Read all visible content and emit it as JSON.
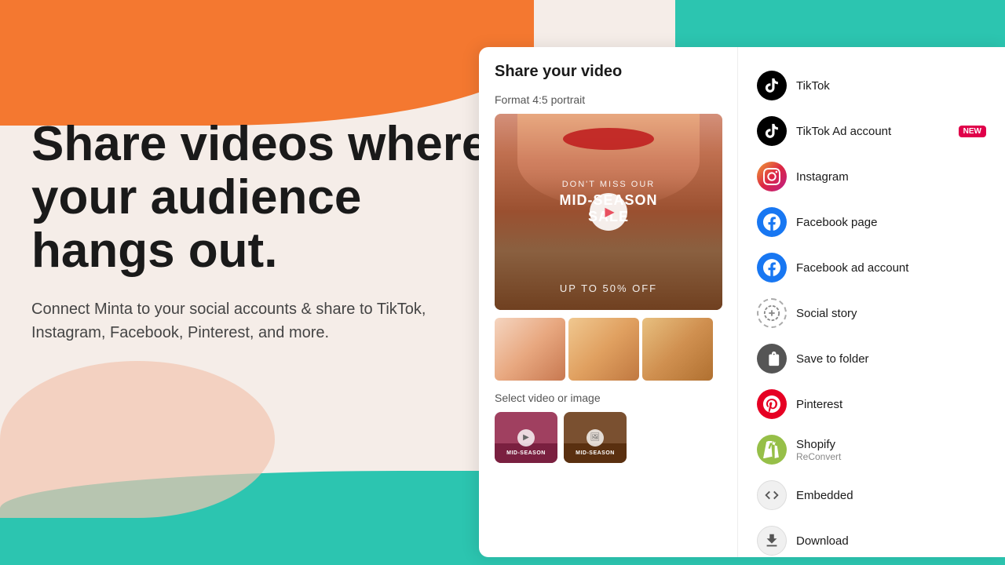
{
  "background": {
    "colors": {
      "orange": "#f47830",
      "teal": "#2cc5b0",
      "pink": "#f2c5b0",
      "cream": "#f5ede8"
    }
  },
  "left": {
    "heading": "Share videos where your audience hangs out.",
    "subtext": "Connect Minta to your social accounts & share to TikTok, Instagram, Facebook, Pinterest, and more."
  },
  "panel": {
    "title": "Share your video",
    "format_label": "Format 4:5 portrait",
    "video_overlay": {
      "dont_miss": "DON'T MISS OUR",
      "mid_season": "MID-SEASON SALE",
      "up_off": "UP TO 50% OFF"
    },
    "select_label": "Select video or image"
  },
  "share_options": [
    {
      "id": "tiktok",
      "name": "TikTok",
      "icon_type": "tiktok",
      "badge": null
    },
    {
      "id": "tiktok-ad",
      "name": "TikTok Ad account",
      "icon_type": "tiktok",
      "badge": "NEW"
    },
    {
      "id": "instagram",
      "name": "Instagram",
      "icon_type": "instagram",
      "badge": null
    },
    {
      "id": "facebook-page",
      "name": "Facebook page",
      "icon_type": "facebook",
      "badge": null
    },
    {
      "id": "facebook-ad",
      "name": "Facebook ad account",
      "icon_type": "facebook",
      "badge": null
    },
    {
      "id": "social-story",
      "name": "Social story",
      "icon_type": "social-story",
      "badge": null
    },
    {
      "id": "save-folder",
      "name": "Save to folder",
      "icon_type": "save",
      "badge": null
    },
    {
      "id": "pinterest",
      "name": "Pinterest",
      "icon_type": "pinterest",
      "badge": null
    },
    {
      "id": "shopify",
      "name": "Shopify",
      "icon_type": "shopify",
      "subtext": "ReConvert",
      "badge": null
    },
    {
      "id": "embedded",
      "name": "Embedded",
      "icon_type": "embedded",
      "badge": null
    },
    {
      "id": "download",
      "name": "Download",
      "icon_type": "download",
      "badge": null
    }
  ]
}
